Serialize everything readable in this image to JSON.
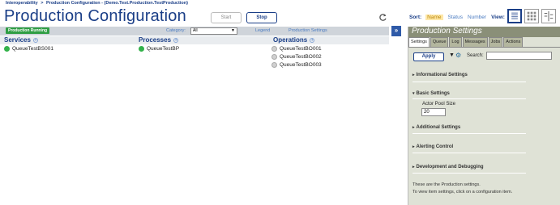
{
  "breadcrumb": {
    "root": "Interoperability",
    "separator": ">",
    "current": "Production Configuration",
    "context": "- (Demo.Test.Production.TestProduction)"
  },
  "page_title": "Production Configuration",
  "actions": {
    "start_label": "Start",
    "stop_label": "Stop"
  },
  "sort": {
    "label": "Sort:",
    "options": [
      "Name",
      "Status",
      "Number"
    ],
    "selected": "Name",
    "view_label": "View:"
  },
  "toolbar": {
    "status": "Production Running",
    "category_label": "Category:",
    "category_value": "All",
    "legend_label": "Legend",
    "production_settings_link": "Production Settings",
    "collapse_label": "»"
  },
  "columns": {
    "services": "Services",
    "processes": "Processes",
    "operations": "Operations",
    "add_symbol": "+"
  },
  "services": [
    {
      "name": "QueueTestBS001",
      "status": "running"
    }
  ],
  "processes": [
    {
      "name": "QueueTestBP",
      "status": "running"
    }
  ],
  "operations": [
    {
      "name": "QueueTestBO001",
      "status": "disabled"
    },
    {
      "name": "QueueTestBO002",
      "status": "disabled"
    },
    {
      "name": "QueueTestBO003",
      "status": "disabled"
    }
  ],
  "panel": {
    "title": "Production Settings",
    "tabs": [
      "Settings",
      "Queue",
      "Log",
      "Messages",
      "Jobs",
      "Actions"
    ],
    "active_tab": "Settings",
    "apply_label": "Apply",
    "search_label": "Search:",
    "search_value": "",
    "sections": {
      "informational": "Informational Settings",
      "basic": "Basic Settings",
      "additional": "Additional Settings",
      "alerting": "Alerting Control",
      "development": "Development and Debugging"
    },
    "actor_pool_label": "Actor Pool Size",
    "actor_pool_value": "20",
    "info_line1": "These are the Production settings.",
    "info_line2": "To view item settings, click on a configuration item."
  },
  "colors": {
    "brand": "#1a3e87",
    "running": "#33b24a",
    "panel_header": "#8a8f78",
    "panel_bg": "#dfe2d6"
  }
}
